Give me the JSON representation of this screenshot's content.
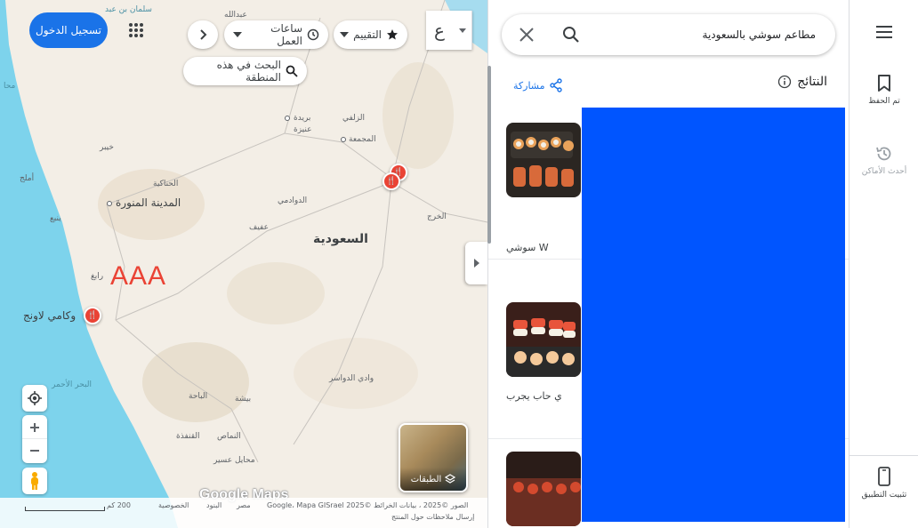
{
  "search": {
    "value": "مطاعم سوشي بالسعودية"
  },
  "panel": {
    "results_title": "النتائج",
    "share_label": "مشاركة",
    "results": [
      {
        "name": "W  سوشي"
      },
      {
        "name": "ي حاب يجرب"
      },
      {
        "name": ""
      }
    ]
  },
  "rail": {
    "saved_label": "تم الحفظ",
    "recent_label": "أحدث الأماكن",
    "install_label": "تثبيت التطبيق"
  },
  "map": {
    "signin_label": "تسجيل الدخول",
    "lang_value": "ع",
    "filters": {
      "hours": "ساعات العمل",
      "rating": "التقييم"
    },
    "search_area_label": "البحث في هذه المنطقة",
    "annotation": "AAA",
    "layers_label": "الطبقات",
    "google_label": "Google Maps",
    "labels": {
      "saudi": "السعودية",
      "madinah": "المدينة المنورة",
      "riyadh_pin": "وكامي لاونج",
      "buraidah": "بريدة",
      "unaizah": "عنيزة",
      "zulfi": "الزلفي",
      "majmaah": "المجمعة",
      "dawadmi": "الدوادمي",
      "afif": "عفيف",
      "kharj": "الخرج",
      "hanakiyah": "الحناكية",
      "khaybar": "خيبر",
      "yanbu": "ينبع",
      "umluj": "أملج",
      "rabigh": "رابغ",
      "wadi_dawasir": "وادي الدواسر",
      "bisha": "بيشة",
      "baha": "الباحة",
      "qunfudhah": "القنفذة",
      "namas": "النماص",
      "muhayil": "محايل عسير",
      "red_sea": "البحر الأحمر",
      "salman": "سلمان بن عبد",
      "salman2": "عبدالله",
      "top_left": "محا"
    },
    "footer": {
      "scale": "200 كم",
      "privacy": "الخصوصية",
      "terms": "البنود",
      "country": "مصر",
      "data": "الصور ©2025 ، بيانات الخرائط ©2025 Google، Mapa GISrael",
      "feedback": "إرسال ملاحظات حول المنتج"
    }
  }
}
